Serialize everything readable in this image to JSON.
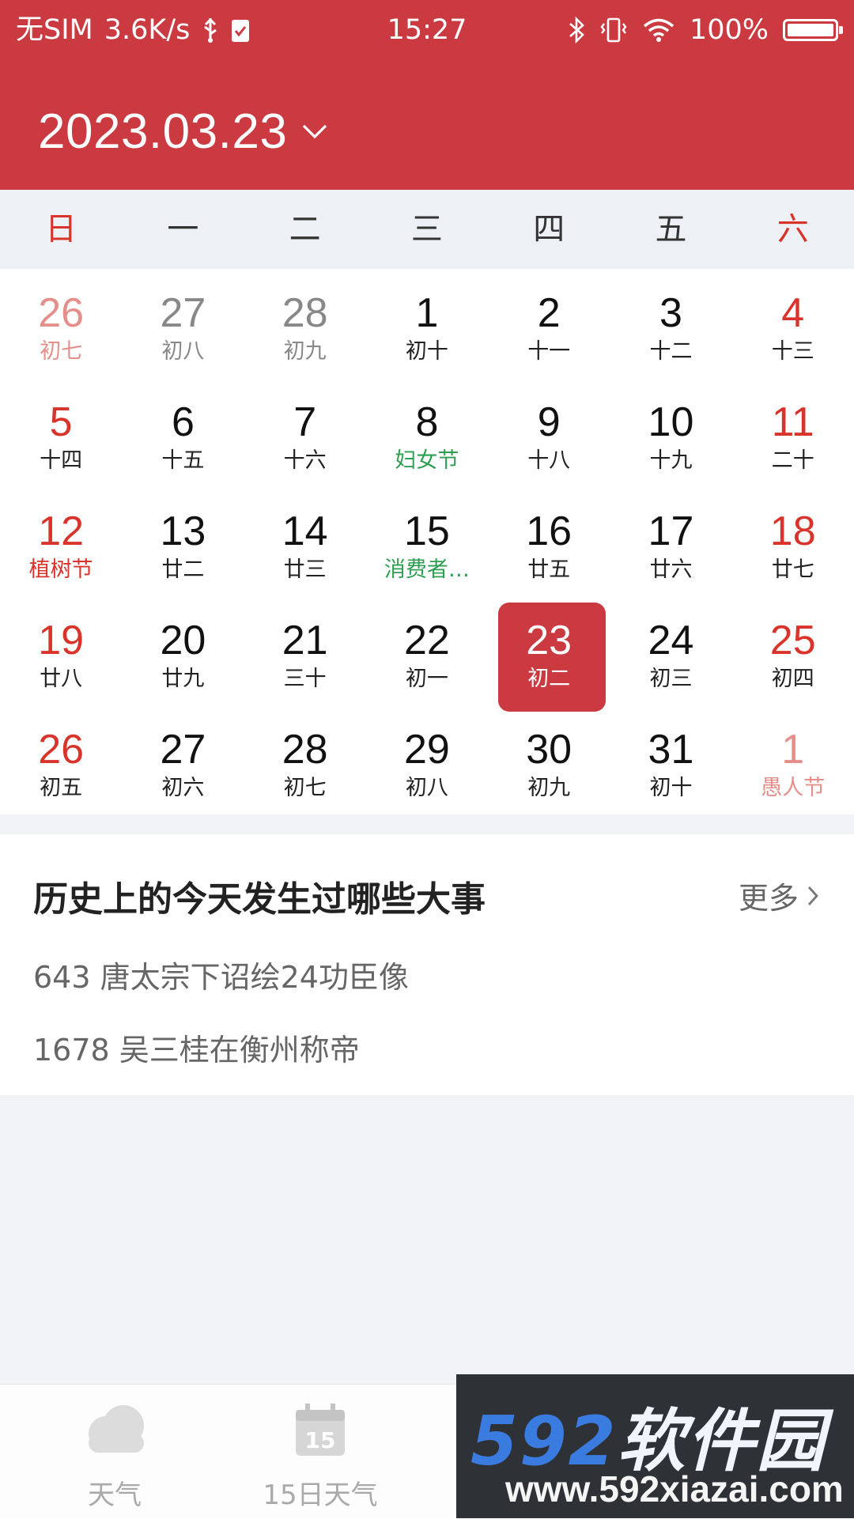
{
  "status_bar": {
    "carrier": "无SIM",
    "speed": "3.6K/s",
    "time": "15:27",
    "battery": "100%",
    "battery_level": 1.0
  },
  "header": {
    "date": "2023.03.23"
  },
  "weekdays": [
    "日",
    "一",
    "二",
    "三",
    "四",
    "五",
    "六"
  ],
  "calendar": {
    "days": [
      {
        "num": "26",
        "lunar": "初七"
      },
      {
        "num": "27",
        "lunar": "初八"
      },
      {
        "num": "28",
        "lunar": "初九"
      },
      {
        "num": "1",
        "lunar": "初十"
      },
      {
        "num": "2",
        "lunar": "十一"
      },
      {
        "num": "3",
        "lunar": "十二"
      },
      {
        "num": "4",
        "lunar": "十三"
      },
      {
        "num": "5",
        "lunar": "十四"
      },
      {
        "num": "6",
        "lunar": "十五"
      },
      {
        "num": "7",
        "lunar": "十六"
      },
      {
        "num": "8",
        "lunar": "妇女节"
      },
      {
        "num": "9",
        "lunar": "十八"
      },
      {
        "num": "10",
        "lunar": "十九"
      },
      {
        "num": "11",
        "lunar": "二十"
      },
      {
        "num": "12",
        "lunar": "植树节"
      },
      {
        "num": "13",
        "lunar": "廿二"
      },
      {
        "num": "14",
        "lunar": "廿三"
      },
      {
        "num": "15",
        "lunar": "消费者…"
      },
      {
        "num": "16",
        "lunar": "廿五"
      },
      {
        "num": "17",
        "lunar": "廿六"
      },
      {
        "num": "18",
        "lunar": "廿七"
      },
      {
        "num": "19",
        "lunar": "廿八"
      },
      {
        "num": "20",
        "lunar": "廿九"
      },
      {
        "num": "21",
        "lunar": "三十"
      },
      {
        "num": "22",
        "lunar": "初一"
      },
      {
        "num": "23",
        "lunar": "初二"
      },
      {
        "num": "24",
        "lunar": "初三"
      },
      {
        "num": "25",
        "lunar": "初四"
      },
      {
        "num": "26",
        "lunar": "初五"
      },
      {
        "num": "27",
        "lunar": "初六"
      },
      {
        "num": "28",
        "lunar": "初七"
      },
      {
        "num": "29",
        "lunar": "初八"
      },
      {
        "num": "30",
        "lunar": "初九"
      },
      {
        "num": "31",
        "lunar": "初十"
      },
      {
        "num": "1",
        "lunar": "愚人节"
      }
    ]
  },
  "history": {
    "title": "历史上的今天发生过哪些大事",
    "more": "更多",
    "events": [
      "643 唐太宗下诏绘24功臣像",
      "1678 吴三桂在衡州称帝"
    ]
  },
  "bottom_nav": {
    "items": [
      {
        "label": "天气",
        "icon": "cloud-icon"
      },
      {
        "label": "15日天气",
        "icon": "calendar-15-icon",
        "icon_text": "15"
      }
    ]
  },
  "watermark": {
    "logo_digits": "592",
    "logo_cn": "软件园",
    "url": "www.592xiazai.com"
  },
  "colors": {
    "accent": "#cb3a41",
    "weekend_red": "#d8342c",
    "festival_green": "#2e9e53"
  }
}
